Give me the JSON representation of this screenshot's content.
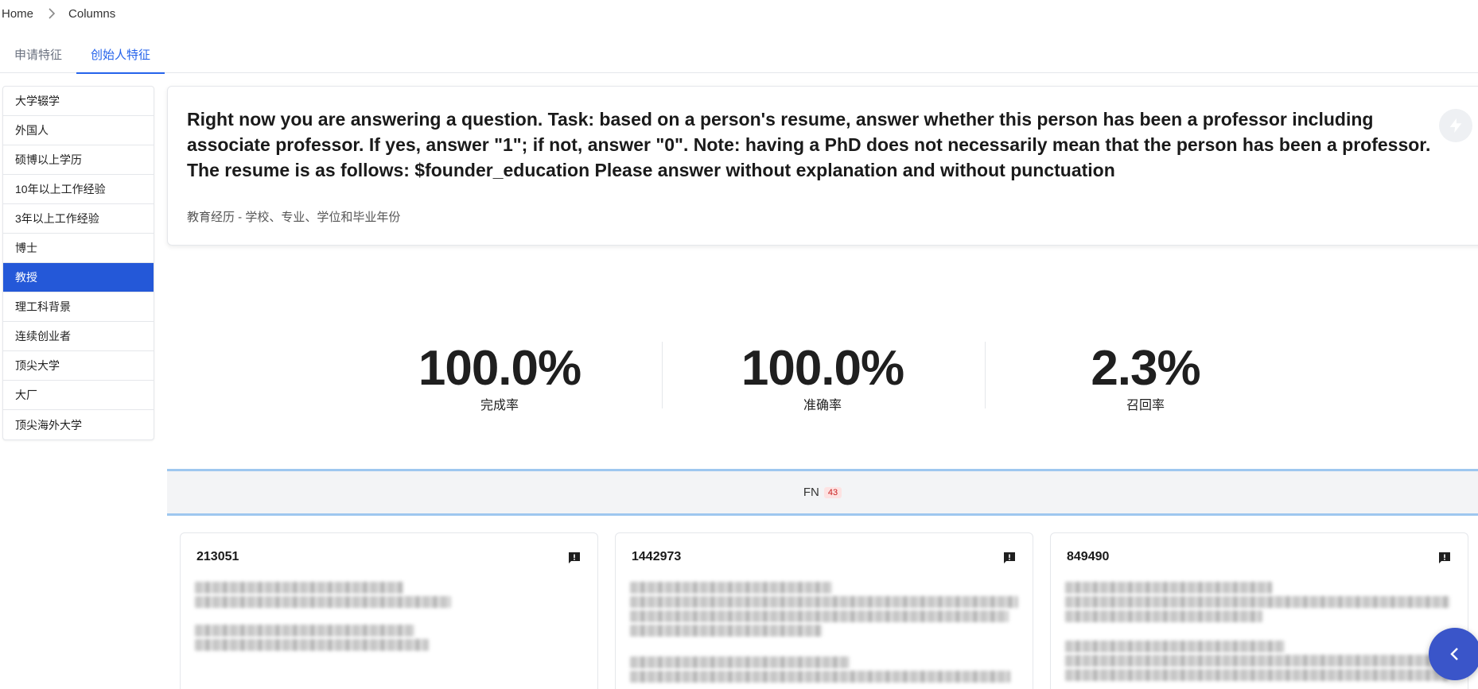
{
  "breadcrumb": {
    "home": "Home",
    "current": "Columns"
  },
  "tabs": [
    {
      "label": "申请特征"
    },
    {
      "label": "创始人特征"
    }
  ],
  "sidebar": {
    "items": [
      {
        "label": "大学辍学"
      },
      {
        "label": "外国人"
      },
      {
        "label": "硕博以上学历"
      },
      {
        "label": "10年以上工作经验"
      },
      {
        "label": "3年以上工作经验"
      },
      {
        "label": "博士"
      },
      {
        "label": "教授"
      },
      {
        "label": "理工科背景"
      },
      {
        "label": "连续创业者"
      },
      {
        "label": "顶尖大学"
      },
      {
        "label": "大厂"
      },
      {
        "label": "顶尖海外大学"
      }
    ],
    "selected": "教授"
  },
  "prompt": {
    "text": "Right now you are answering a question. Task: based on a person's resume, answer whether this person has been a professor including associate professor. If yes, answer \"1\"; if not, answer \"0\". Note: having a PhD does not necessarily mean that the person has been a professor. The resume is as follows: $founder_education Please answer without explanation and without punctuation",
    "field_description": "教育经历 - 学校、专业、学位和毕业年份",
    "action_icon": "lightning-bolt-icon"
  },
  "stats": [
    {
      "value": "100.0%",
      "label": "完成率"
    },
    {
      "value": "100.0%",
      "label": "准确率"
    },
    {
      "value": "2.3%",
      "label": "召回率"
    }
  ],
  "fn_section": {
    "label": "FN",
    "count": "43"
  },
  "cards": [
    {
      "id": "213051",
      "icon": "feedback-icon"
    },
    {
      "id": "1442973",
      "icon": "feedback-icon"
    },
    {
      "id": "849490",
      "icon": "feedback-icon"
    }
  ],
  "colors": {
    "accent": "#2563eb",
    "sidebar_selected": "#2458d8",
    "fn_border": "#9ec7ef",
    "badge_text": "#c81e1e",
    "float_button": "#3a55c9"
  }
}
